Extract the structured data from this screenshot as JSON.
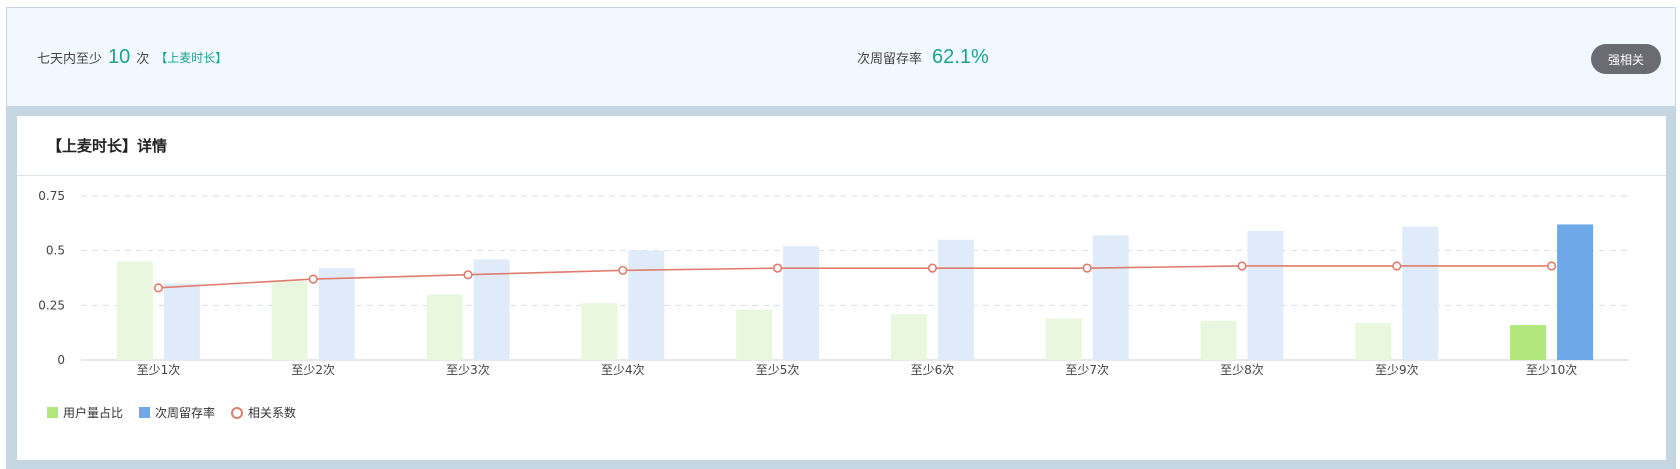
{
  "summary": {
    "prefix": "七天内至少",
    "count": "10",
    "unit": "次",
    "metric": "【上麦时长】",
    "retention_label": "次周留存率",
    "retention_value": "62.1%",
    "badge": "强相关"
  },
  "panel": {
    "title": "【上麦时长】详情"
  },
  "colors": {
    "user_share": "#b2e77e",
    "user_share_light": "#eaf7df",
    "retention": "#6fa8e8",
    "retention_light": "#dfebf8",
    "correlation": "#e07c6e",
    "accent": "#1aa391"
  },
  "chart_data": {
    "type": "bar",
    "categories": [
      "至少1次",
      "至少2次",
      "至少3次",
      "至少4次",
      "至少5次",
      "至少6次",
      "至少7次",
      "至少8次",
      "至少9次",
      "至少10次"
    ],
    "ylim": [
      0,
      0.75
    ],
    "yticks": [
      "0",
      "0.25",
      "0.5",
      "0.75"
    ],
    "grid": true,
    "highlighted_category": "至少10次",
    "series": [
      {
        "name": "用户量占比",
        "type": "bar",
        "values": [
          0.45,
          0.36,
          0.3,
          0.26,
          0.23,
          0.21,
          0.19,
          0.18,
          0.17,
          0.16
        ]
      },
      {
        "name": "次周留存率",
        "type": "bar",
        "values": [
          0.35,
          0.42,
          0.46,
          0.5,
          0.52,
          0.55,
          0.57,
          0.59,
          0.61,
          0.62
        ]
      },
      {
        "name": "相关系数",
        "type": "line",
        "values": [
          0.33,
          0.37,
          0.39,
          0.41,
          0.42,
          0.42,
          0.42,
          0.43,
          0.43,
          0.43
        ]
      }
    ],
    "legend_position": "bottom-left"
  }
}
